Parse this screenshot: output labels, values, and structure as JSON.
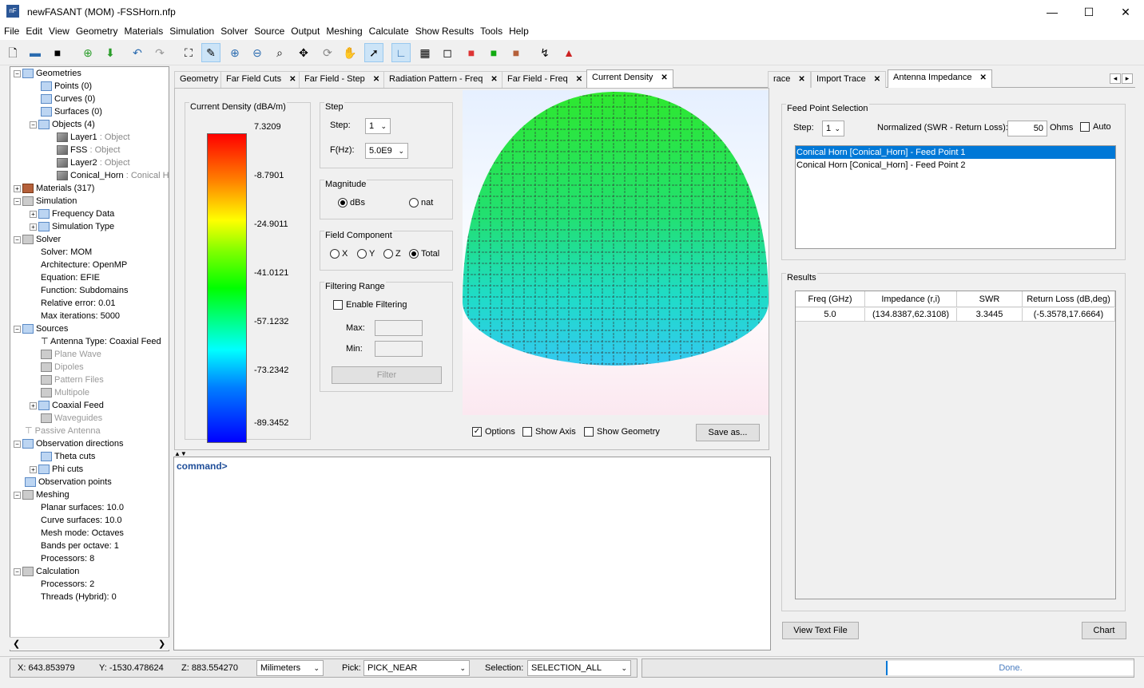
{
  "window": {
    "title": "newFASANT (MOM) -FSSHorn.nfp",
    "icon": "nF",
    "min": "—",
    "max": "☐",
    "close": "✕"
  },
  "menu": [
    "File",
    "Edit",
    "View",
    "Geometry",
    "Materials",
    "Simulation",
    "Solver",
    "Source",
    "Output",
    "Meshing",
    "Calculate",
    "Show Results",
    "Tools",
    "Help"
  ],
  "toolbar": [
    "new-file-icon",
    "open-folder-icon",
    "save-icon",
    "add-icon",
    "download-icon",
    "undo-icon",
    "redo-icon",
    "fit-view-icon",
    "select-pen-icon",
    "zoom-in-icon",
    "zoom-out-icon",
    "zoom-box-icon",
    "pan-icon",
    "rotate-icon",
    "hand-icon",
    "pointer-icon",
    "axis-icon",
    "grid-icon",
    "cube-wire-icon",
    "cube-color-icon",
    "cube-green-icon",
    "cube-brown-icon",
    "probe-icon",
    "antenna-icon"
  ],
  "tree": {
    "geometries": "Geometries",
    "points": "Points (0)",
    "curves": "Curves (0)",
    "surfaces": "Surfaces (0)",
    "objects": "Objects (4)",
    "layer1": "Layer1",
    "layer1_t": ": Object",
    "fss": "FSS",
    "fss_t": ": Object",
    "layer2": "Layer2",
    "layer2_t": ": Object",
    "horn": "Conical_Horn",
    "horn_t": ": Conical Ho",
    "materials": "Materials (317)",
    "simulation": "Simulation",
    "freq": "Frequency Data",
    "simtype": "Simulation Type",
    "solver": "Solver",
    "solver_mom": "Solver: MOM",
    "arch": "Architecture: OpenMP",
    "eq": "Equation: EFIE",
    "func": "Function: Subdomains",
    "relerr": "Relative error: 0.01",
    "maxit": "Max iterations: 5000",
    "sources": "Sources",
    "antenna": "Antenna Type: Coaxial Feed",
    "plane": "Plane Wave",
    "dipoles": "Dipoles",
    "pattern": "Pattern Files",
    "multipole": "Multipole",
    "coax": "Coaxial Feed",
    "waveguides": "Waveguides",
    "passive": "Passive Antenna",
    "obsdir": "Observation directions",
    "theta": "Theta cuts",
    "phi": "Phi cuts",
    "obspts": "Observation points",
    "meshing": "Meshing",
    "planar": "Planar surfaces: 10.0",
    "curve": "Curve surfaces: 10.0",
    "meshmode": "Mesh mode: Octaves",
    "bands": "Bands per octave: 1",
    "procs8": "Processors: 8",
    "calc": "Calculation",
    "procs2": "Processors: 2",
    "threads": "Threads (Hybrid): 0"
  },
  "center_tabs": [
    "Geometry",
    "Far Field Cuts",
    "Far Field - Step",
    "Radiation Pattern - Freq",
    "Far Field - Freq",
    "Current Density"
  ],
  "tab_close": "✕",
  "current_density": {
    "colorbar_title": "Current Density (dBA/m)",
    "ticks": [
      "7.3209",
      "-8.7901",
      "-24.9011",
      "-41.0121",
      "-57.1232",
      "-73.2342",
      "-89.3452"
    ],
    "step_group": "Step",
    "step_label": "Step:",
    "step_value": "1",
    "fhz_label": "F(Hz):",
    "fhz_value": "5.0E9",
    "magnitude_group": "Magnitude",
    "dbs": "dBs",
    "nat": "nat",
    "field_group": "Field Component",
    "fx": "X",
    "fy": "Y",
    "fz": "Z",
    "ftotal": "Total",
    "filter_group": "Filtering Range",
    "enable_filter": "Enable Filtering",
    "max": "Max:",
    "min": "Min:",
    "filter_btn": "Filter",
    "options": "Options",
    "show_axis": "Show Axis",
    "show_geometry": "Show Geometry",
    "save_as": "Save as..."
  },
  "console": {
    "prompt": "command>"
  },
  "right_tabs": [
    "race",
    "Import Trace",
    "Antenna Impedance"
  ],
  "impedance": {
    "feed_group": "Feed Point Selection",
    "step_label": "Step:",
    "step_value": "1",
    "norm_label": "Normalized (SWR - Return Loss):",
    "norm_value": "50",
    "ohms": "Ohms",
    "auto": "Auto",
    "feed_items": [
      "Conical Horn [Conical_Horn] - Feed Point 1",
      "Conical Horn [Conical_Horn] - Feed Point 2"
    ],
    "results_group": "Results",
    "headers": [
      "Freq (GHz)",
      "Impedance (r,i)",
      "SWR",
      "Return Loss (dB,deg)"
    ],
    "row": [
      "5.0",
      "(134.8387,62.3108)",
      "3.3445",
      "(-5.3578,17.6664)"
    ],
    "view_text": "View Text File",
    "chart": "Chart"
  },
  "status": {
    "x": "X: 643.853979",
    "y": "Y: -1530.478624",
    "z": "Z: 883.554270",
    "units": "Milimeters",
    "pick_label": "Pick:",
    "pick_value": "PICK_NEAR",
    "sel_label": "Selection:",
    "sel_value": "SELECTION_ALL",
    "done": "Done."
  }
}
